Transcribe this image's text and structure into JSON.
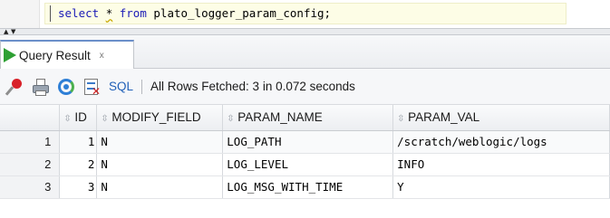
{
  "editor": {
    "kw_select": "select",
    "star": "*",
    "kw_from": "from",
    "table_ref": "plato_logger_param_config;"
  },
  "result_tab": {
    "label": "Query Result",
    "close": "x"
  },
  "toolbar": {
    "icons": [
      "pin-icon",
      "print-icon",
      "refresh-icon",
      "export-icon"
    ],
    "sql_label": "SQL",
    "separator": "|",
    "status": "All Rows Fetched: 3 in 0.072 seconds"
  },
  "grid": {
    "sort_glyph": "⇳",
    "headers": [
      "ID",
      "MODIFY_FIELD",
      "PARAM_NAME",
      "PARAM_VAL"
    ],
    "rows": [
      {
        "num": "1",
        "id": "1",
        "modify_field": "N",
        "param_name": "LOG_PATH",
        "param_val": "/scratch/weblogic/logs"
      },
      {
        "num": "2",
        "id": "2",
        "modify_field": "N",
        "param_name": "LOG_LEVEL",
        "param_val": "INFO"
      },
      {
        "num": "3",
        "id": "3",
        "modify_field": "N",
        "param_name": "LOG_MSG_WITH_TIME",
        "param_val": "Y"
      }
    ]
  },
  "colors": {
    "keyword": "#1b1bb6",
    "run_icon": "#2ea033",
    "sql_link": "#1f5fb7"
  }
}
